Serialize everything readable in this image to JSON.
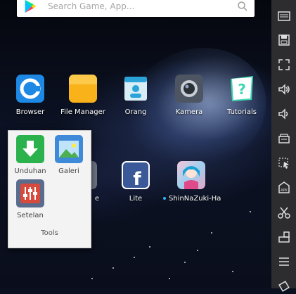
{
  "search": {
    "placeholder": "Search Game, App..."
  },
  "desktop_apps": [
    {
      "label": "Browser",
      "icon": "browser-icon"
    },
    {
      "label": "File Manager",
      "icon": "file-manager-icon"
    },
    {
      "label": "Orang",
      "icon": "contacts-icon"
    },
    {
      "label": "Kamera",
      "icon": "camera-icon"
    },
    {
      "label": "Tutorials",
      "icon": "tutorials-icon"
    },
    {
      "label": "e",
      "icon": "partially-hidden-app-icon"
    },
    {
      "label": "Lite",
      "icon": "facebook-lite-icon"
    },
    {
      "label": "ShinNaZuki-Ha",
      "icon": "shinnazuki-game-icon"
    }
  ],
  "folder": {
    "title": "Tools",
    "apps": [
      {
        "label": "Unduhan",
        "icon": "download-icon"
      },
      {
        "label": "Galeri",
        "icon": "gallery-icon"
      },
      {
        "label": "Setelan",
        "icon": "settings-icon"
      }
    ]
  },
  "sidebar": {
    "items": [
      {
        "icon": "keyboard-icon"
      },
      {
        "icon": "save-icon"
      },
      {
        "icon": "fullscreen-icon"
      },
      {
        "icon": "volume-up-icon"
      },
      {
        "icon": "volume-down-icon"
      },
      {
        "icon": "screenshot-icon"
      },
      {
        "icon": "multi-instance-icon"
      },
      {
        "icon": "apk-install-icon"
      },
      {
        "icon": "scissors-icon"
      },
      {
        "icon": "rotate-screen-icon"
      },
      {
        "icon": "menu-icon"
      },
      {
        "icon": "shake-icon"
      }
    ]
  },
  "colors": {
    "sidebar_bg": "#2d2d30",
    "folder_bg": "#f3f3f3",
    "browser_blue": "#1e88e5",
    "file_manager_yellow": "#f9b21a",
    "download_green": "#2bb24c",
    "gallery_blue": "#3e8ad8",
    "settings_slate": "#5a6b8c",
    "facebook_blue": "#3b5998",
    "new_app_dot": "#29b6f6"
  }
}
